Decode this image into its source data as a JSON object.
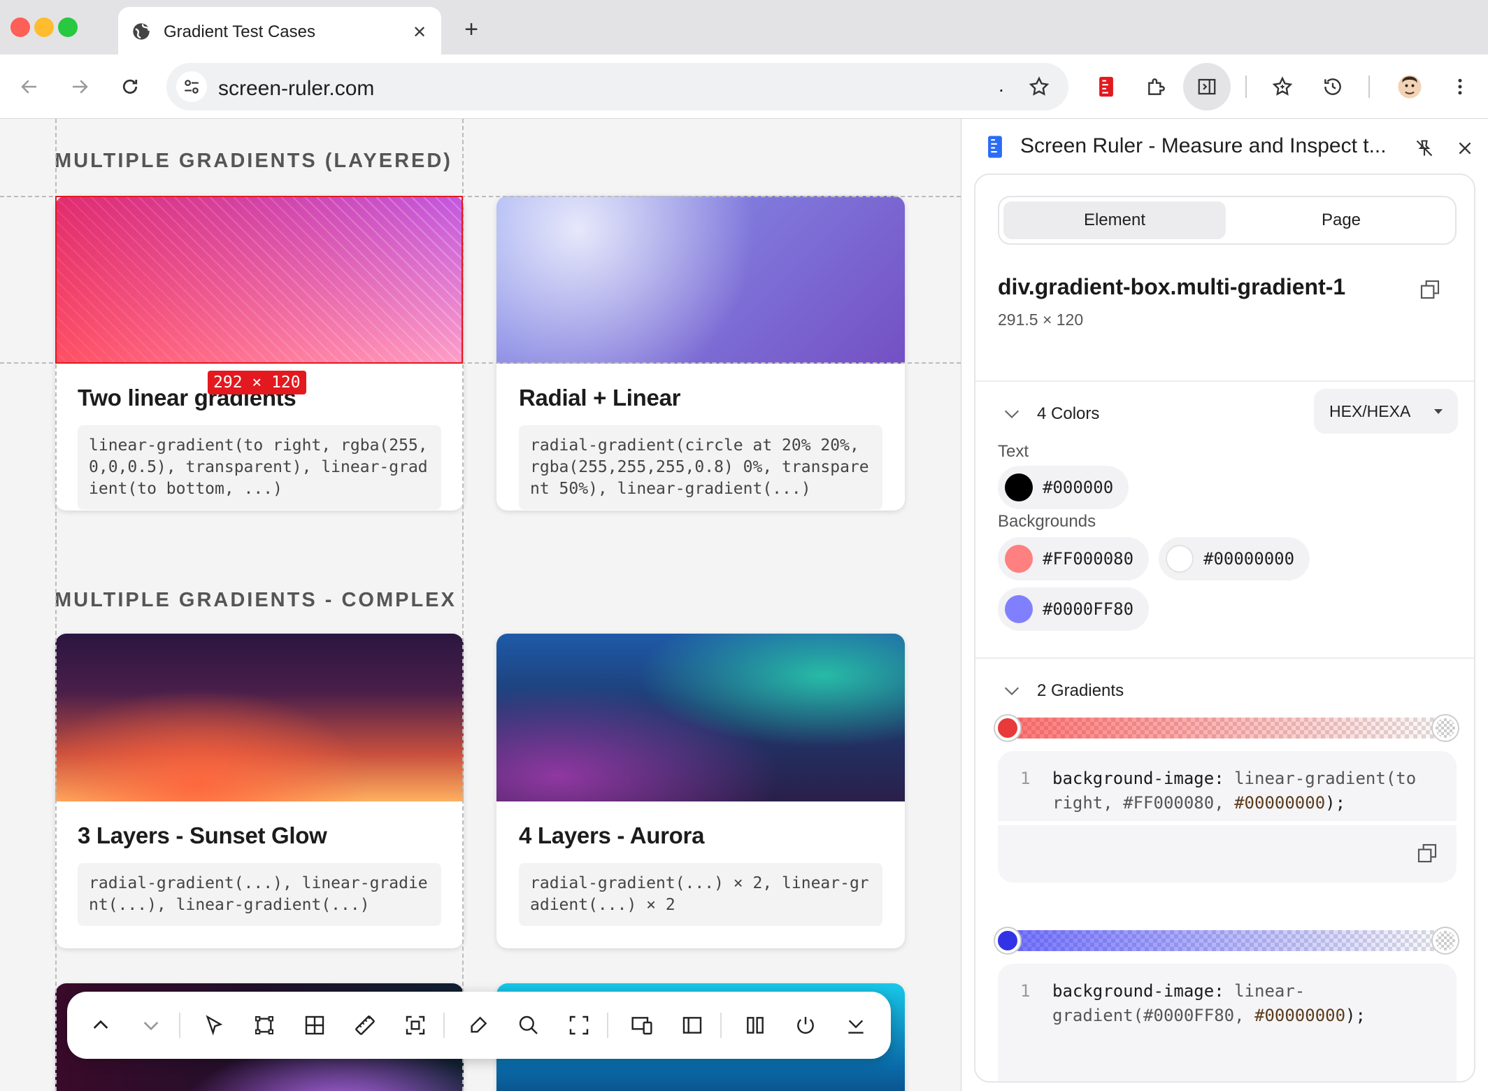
{
  "browser": {
    "tab_title": "Gradient Test Cases",
    "new_tab": "+",
    "close_tab": "✕",
    "url": "screen-ruler.com",
    "url_dot": "."
  },
  "page": {
    "section1": "MULTIPLE GRADIENTS (LAYERED)",
    "section2": "MULTIPLE GRADIENTS - COMPLEX",
    "dimension_badge": "292 × 120",
    "cards": [
      {
        "title": "Two linear gradients",
        "code": "linear-gradient(to right, rgba(255,0,0,0.5), transparent), linear-gradient(to bottom, ...)"
      },
      {
        "title": "Radial + Linear",
        "code": "radial-gradient(circle at 20% 20%, rgba(255,255,255,0.8) 0%, transparent 50%), linear-gradient(...)"
      },
      {
        "title": "3 Layers - Sunset Glow",
        "code": "radial-gradient(...), linear-gradient(...), linear-gradient(...)"
      },
      {
        "title": "4 Layers - Aurora",
        "code": "radial-gradient(...) × 2, linear-gradient(...) × 2"
      }
    ]
  },
  "panel": {
    "title": "Screen Ruler - Measure and Inspect t...",
    "tab_element": "Element",
    "tab_page": "Page",
    "selector": "div.gradient-box.multi-gradient-1",
    "dimensions": "291.5 × 120",
    "colors_header": "4 Colors",
    "format": "HEX/HEXA",
    "text_label": "Text",
    "text_color": {
      "hex": "#000000",
      "swatch": "#000000"
    },
    "backgrounds_label": "Backgrounds",
    "backgrounds": [
      {
        "hex": "#FF000080",
        "swatch": "#ff8080"
      },
      {
        "hex": "#00000000",
        "swatch": "transparent"
      },
      {
        "hex": "#0000FF80",
        "swatch": "#8080ff"
      }
    ],
    "gradients_header": "2 Gradients",
    "gradient_code": [
      {
        "line": "1",
        "prop": "background-image:",
        "fn": "linear-gradient(to right,",
        "c1": "#FF000080,",
        "c2": "#00000000",
        "end": ");"
      },
      {
        "line": "1",
        "prop": "background-image:",
        "fn": "linear-gradient(",
        "c1": "#0000FF80,",
        "c2": "#00000000",
        "end": ");"
      }
    ]
  }
}
